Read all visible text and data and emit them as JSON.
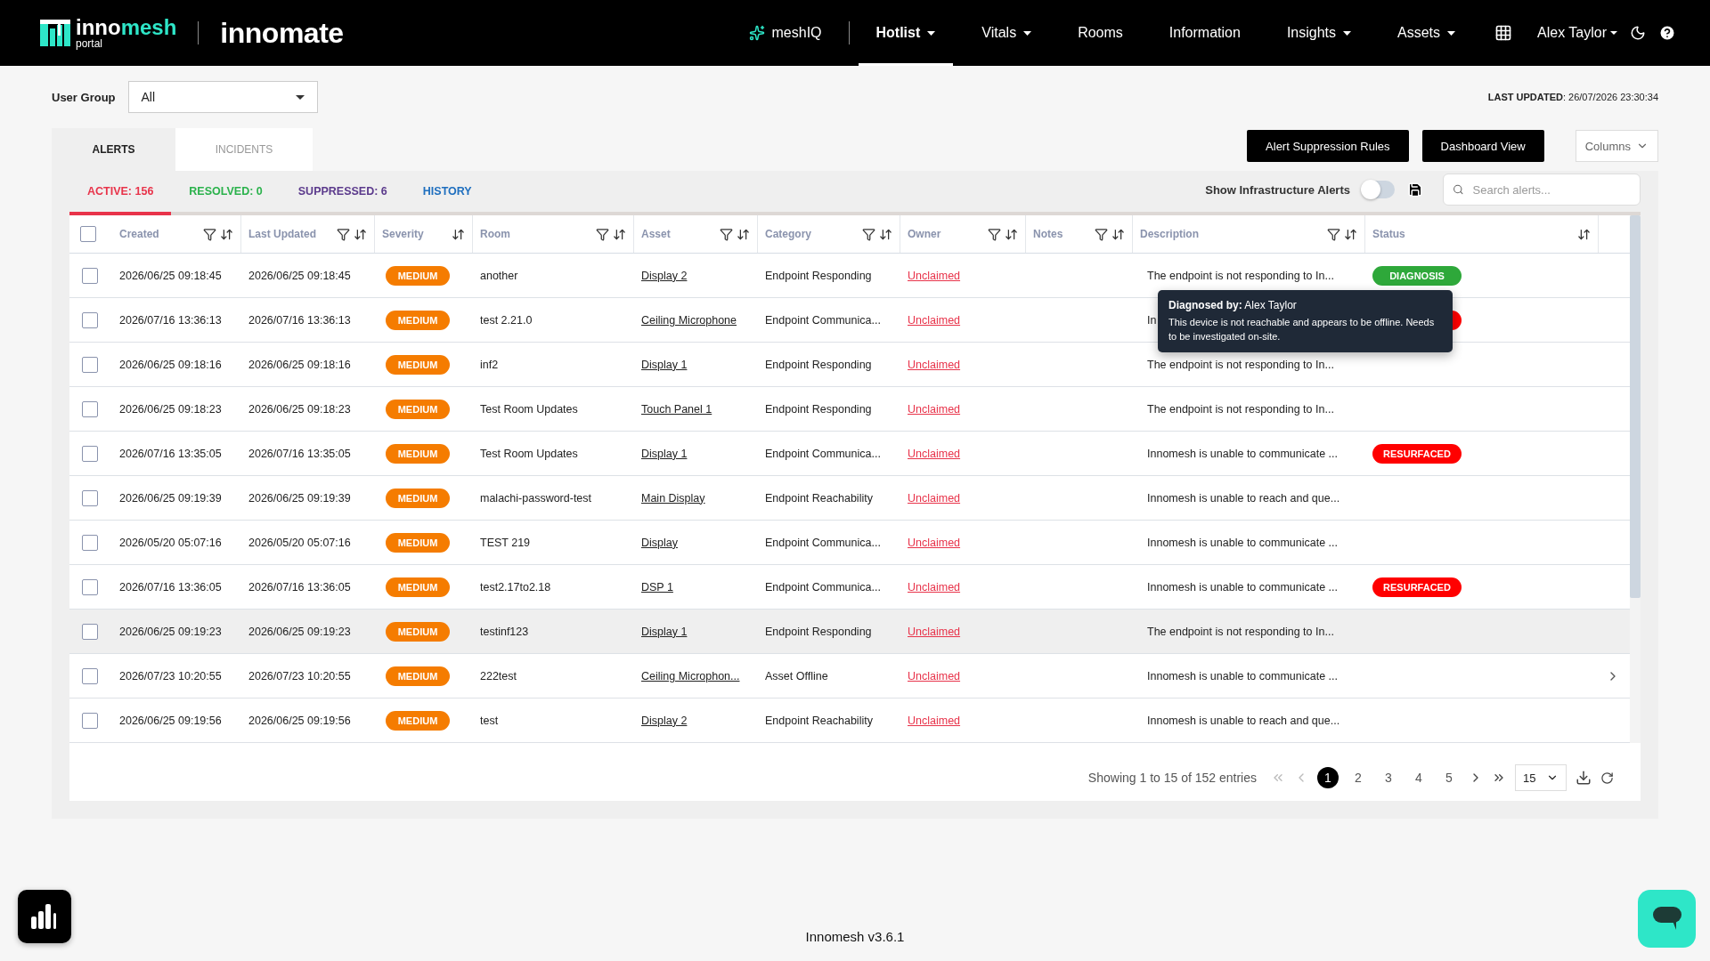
{
  "navbar": {
    "logo": {
      "prefix": "inno",
      "suffix": "mesh",
      "sub": "portal"
    },
    "product": "innomate",
    "items": [
      {
        "label": "meshIQ",
        "kind": "ai",
        "dropdown": false,
        "selected": false
      },
      {
        "label": "Hotlist",
        "kind": "link",
        "dropdown": true,
        "selected": true
      },
      {
        "label": "Vitals",
        "kind": "link",
        "dropdown": true,
        "selected": false
      },
      {
        "label": "Rooms",
        "kind": "link",
        "dropdown": false,
        "selected": false
      },
      {
        "label": "Information",
        "kind": "link",
        "dropdown": false,
        "selected": false
      },
      {
        "label": "Insights",
        "kind": "link",
        "dropdown": true,
        "selected": false
      },
      {
        "label": "Assets",
        "kind": "link",
        "dropdown": true,
        "selected": false
      }
    ],
    "user": "Alex Taylor"
  },
  "user_group": {
    "label": "User Group",
    "value": "All"
  },
  "last_updated": "**LAST UPDATED**: 26/07/2026 23:30:34",
  "view_tabs": [
    {
      "label": "ALERTS",
      "selected": true
    },
    {
      "label": "INCIDENTS",
      "selected": false
    }
  ],
  "actions": [
    "Alert Suppression Rules",
    "Dashboard View"
  ],
  "columns_button": "Columns",
  "status_tabs": [
    {
      "label": "ACTIVE: 156",
      "color": "#e8334a",
      "selected": true
    },
    {
      "label": "RESOLVED: 0",
      "color": "#2bb24c",
      "selected": false
    },
    {
      "label": "SUPPRESSED: 6",
      "color": "#5b3a8c",
      "selected": false
    },
    {
      "label": "HISTORY",
      "color": "#1f6fbf",
      "selected": false
    }
  ],
  "infra_toggle": {
    "label": "Show Infrastructure Alerts",
    "on": false
  },
  "search": {
    "placeholder": "Search alerts..."
  },
  "table": {
    "select_all": {
      "checked": false
    },
    "columns": [
      {
        "label": "Created",
        "filter": true,
        "sort": true
      },
      {
        "label": "Last Updated",
        "filter": true,
        "sort": true
      },
      {
        "label": "Severity",
        "filter": false,
        "sort": true
      },
      {
        "label": "Room",
        "filter": true,
        "sort": true
      },
      {
        "label": "Asset",
        "filter": true,
        "sort": true
      },
      {
        "label": "Category",
        "filter": true,
        "sort": true
      },
      {
        "label": "Owner",
        "filter": true,
        "sort": true
      },
      {
        "label": "Notes",
        "filter": true,
        "sort": true
      },
      {
        "label": "Description",
        "filter": true,
        "sort": true
      },
      {
        "label": "Status",
        "filter": false,
        "sort": true
      }
    ],
    "rows": [
      {
        "checked": false,
        "created": "2026/06/25 09:18:45",
        "last_updated": "2026/06/25 09:18:45",
        "severity": "MEDIUM",
        "room": "another",
        "asset": "Display 2",
        "category": "Endpoint Responding",
        "owner": "Unclaimed",
        "description": "The endpoint is not responding to In...",
        "status": {
          "label": "DIAGNOSIS",
          "color": "#2ea83a"
        },
        "highlighted": false,
        "chevron": false
      },
      {
        "checked": false,
        "created": "2026/07/16 13:36:13",
        "last_updated": "2026/07/16 13:36:13",
        "severity": "MEDIUM",
        "room": "test 2.21.0",
        "asset": "Ceiling Microphone",
        "category": "Endpoint Communica...",
        "owner": "Unclaimed",
        "description": "In",
        "status": {
          "color": "#ff0000"
        },
        "highlighted": false,
        "chevron": false
      },
      {
        "checked": false,
        "created": "2026/06/25 09:18:16",
        "last_updated": "2026/06/25 09:18:16",
        "severity": "MEDIUM",
        "room": "inf2",
        "asset": "Display 1",
        "category": "Endpoint Responding",
        "owner": "Unclaimed",
        "description": "The endpoint is not responding to In...",
        "highlighted": false,
        "chevron": false
      },
      {
        "checked": false,
        "created": "2026/06/25 09:18:23",
        "last_updated": "2026/06/25 09:18:23",
        "severity": "MEDIUM",
        "room": "Test Room Updates",
        "asset": "Touch Panel 1",
        "category": "Endpoint Responding",
        "owner": "Unclaimed",
        "description": "The endpoint is not responding to In...",
        "highlighted": false,
        "chevron": false
      },
      {
        "checked": false,
        "created": "2026/07/16 13:35:05",
        "last_updated": "2026/07/16 13:35:05",
        "severity": "MEDIUM",
        "room": "Test Room Updates",
        "asset": "Display 1",
        "category": "Endpoint Communica...",
        "owner": "Unclaimed",
        "description": "Innomesh is unable to communicate ...",
        "status": {
          "label": "RESURFACED",
          "color": "#ff0000"
        },
        "highlighted": false,
        "chevron": false
      },
      {
        "checked": false,
        "created": "2026/06/25 09:19:39",
        "last_updated": "2026/06/25 09:19:39",
        "severity": "MEDIUM",
        "room": "malachi-password-test",
        "asset": "Main Display",
        "category": "Endpoint Reachability",
        "owner": "Unclaimed",
        "description": "Innomesh is unable to reach and que...",
        "highlighted": false,
        "chevron": false
      },
      {
        "checked": false,
        "created": "2026/05/20 05:07:16",
        "last_updated": "2026/05/20 05:07:16",
        "severity": "MEDIUM",
        "room": "TEST 219",
        "asset": "Display",
        "category": "Endpoint Communica...",
        "owner": "Unclaimed",
        "description": "Innomesh is unable to communicate ...",
        "highlighted": false,
        "chevron": false
      },
      {
        "checked": false,
        "created": "2026/07/16 13:36:05",
        "last_updated": "2026/07/16 13:36:05",
        "severity": "MEDIUM",
        "room": "test2.17to2.18",
        "asset": "DSP 1",
        "category": "Endpoint Communica...",
        "owner": "Unclaimed",
        "description": "Innomesh is unable to communicate ...",
        "status": {
          "label": "RESURFACED",
          "color": "#ff0000"
        },
        "highlighted": false,
        "chevron": false
      },
      {
        "checked": false,
        "created": "2026/06/25 09:19:23",
        "last_updated": "2026/06/25 09:19:23",
        "severity": "MEDIUM",
        "room": "testinf123",
        "asset": "Display 1",
        "category": "Endpoint Responding",
        "owner": "Unclaimed",
        "description": "The endpoint is not responding to In...",
        "highlighted": true,
        "chevron": false
      },
      {
        "checked": false,
        "created": "2026/07/23 10:20:55",
        "last_updated": "2026/07/23 10:20:55",
        "severity": "MEDIUM",
        "room": "222test",
        "asset": "Ceiling Microphon...",
        "category": "Asset Offline",
        "owner": "Unclaimed",
        "description": "Innomesh is unable to communicate ...",
        "highlighted": false,
        "chevron": true
      },
      {
        "checked": false,
        "created": "2026/06/25 09:19:56",
        "last_updated": "2026/06/25 09:19:56",
        "severity": "MEDIUM",
        "room": "test",
        "asset": "Display 2",
        "category": "Endpoint Reachability",
        "owner": "Unclaimed",
        "description": "Innomesh is unable to reach and que...",
        "highlighted": false,
        "chevron": false
      }
    ]
  },
  "tooltip": {
    "title": "**Diagnosed by:** Alex Taylor",
    "body": "This device is not reachable and appears to be offline. Needs to be investigated on-site."
  },
  "pagination": {
    "summary": "Showing 1 to 15 of 152 entries",
    "nav": [
      {
        "kind": "first",
        "disabled": true
      },
      {
        "kind": "prev",
        "disabled": true
      },
      {
        "kind": "next",
        "disabled": false
      },
      {
        "kind": "last",
        "disabled": false
      }
    ],
    "pages": [
      {
        "label": "1",
        "selected": true
      },
      {
        "label": "2",
        "selected": false
      },
      {
        "label": "3",
        "selected": false
      },
      {
        "label": "4",
        "selected": false
      },
      {
        "label": "5",
        "selected": false
      }
    ],
    "page_size": "15"
  },
  "footer": "Innomesh v3.6.1"
}
